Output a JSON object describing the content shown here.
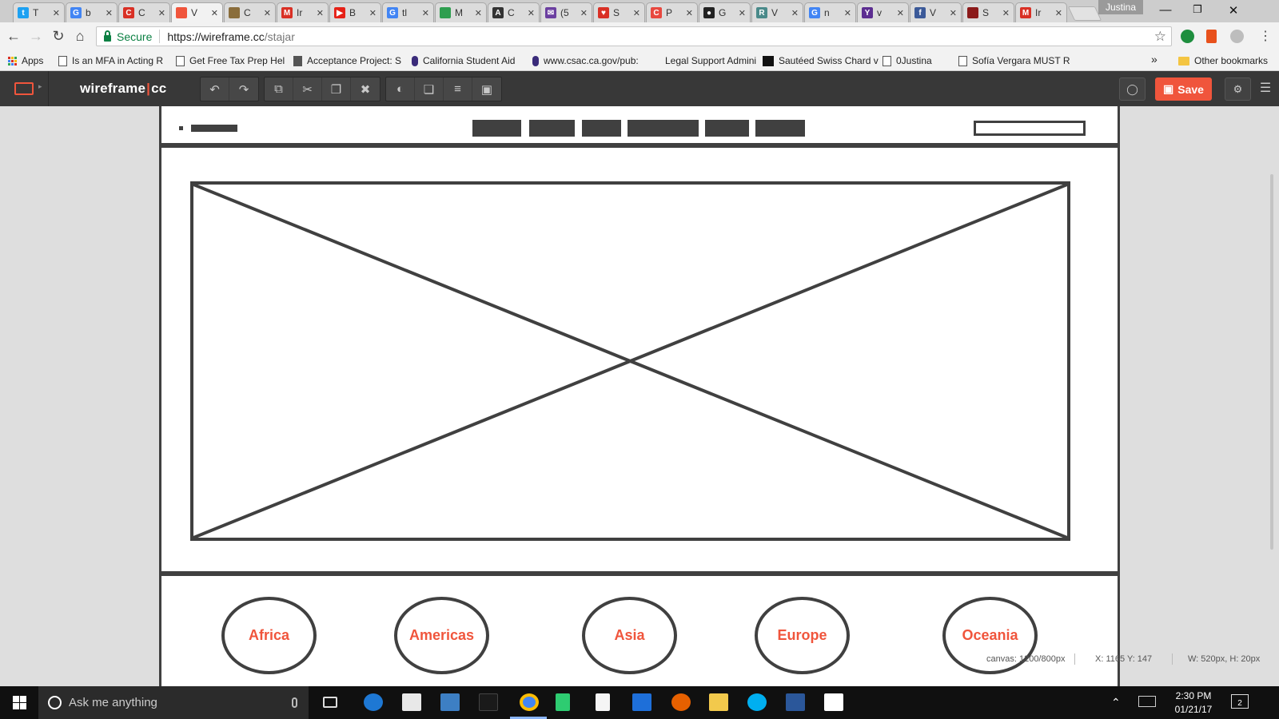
{
  "browser": {
    "tabs": [
      {
        "title": "T",
        "fav": "twitter-icon",
        "color": "#1da1f2",
        "glyph": "t"
      },
      {
        "title": "b",
        "fav": "google-icon",
        "color": "#4285f4",
        "glyph": "G"
      },
      {
        "title": "C",
        "fav": "app-icon",
        "color": "#d93025",
        "glyph": "C"
      },
      {
        "title": "V",
        "fav": "wireframe-icon",
        "color": "#f0553c",
        "glyph": "",
        "active": true
      },
      {
        "title": "C",
        "fav": "chart-icon",
        "color": "#8a6d3b",
        "glyph": ""
      },
      {
        "title": "Ir",
        "fav": "gmail-icon",
        "color": "#d93025",
        "glyph": "M"
      },
      {
        "title": "B",
        "fav": "youtube-icon",
        "color": "#e62117",
        "glyph": "▶"
      },
      {
        "title": "tl",
        "fav": "google-icon",
        "color": "#4285f4",
        "glyph": "G"
      },
      {
        "title": "M",
        "fav": "leaf-icon",
        "color": "#2e9e4f",
        "glyph": ""
      },
      {
        "title": "C",
        "fav": "circle-a-icon",
        "color": "#333333",
        "glyph": "A"
      },
      {
        "title": "(5",
        "fav": "mail-icon",
        "color": "#6b3fa0",
        "glyph": "✉"
      },
      {
        "title": "S",
        "fav": "heart-icon",
        "color": "#d93025",
        "glyph": "♥"
      },
      {
        "title": "P",
        "fav": "letter-c-icon",
        "color": "#e8483f",
        "glyph": "C"
      },
      {
        "title": "G",
        "fav": "github-icon",
        "color": "#222222",
        "glyph": "●"
      },
      {
        "title": "V",
        "fav": "r-icon",
        "color": "#4a8a8a",
        "glyph": "R"
      },
      {
        "title": "n",
        "fav": "google-icon",
        "color": "#4285f4",
        "glyph": "G"
      },
      {
        "title": "v",
        "fav": "yahoo-icon",
        "color": "#5c2d91",
        "glyph": "Y"
      },
      {
        "title": "V",
        "fav": "facebook-icon",
        "color": "#3b5998",
        "glyph": "f"
      },
      {
        "title": "S",
        "fav": "book-icon",
        "color": "#8b1a1a",
        "glyph": ""
      },
      {
        "title": "Ir",
        "fav": "gmail-icon",
        "color": "#d93025",
        "glyph": "M"
      }
    ],
    "profile_name": "Justina",
    "secure_label": "Secure",
    "url_host": "https://wireframe.cc",
    "url_path": "/stajar",
    "bookmarks": [
      {
        "label": "Apps"
      },
      {
        "label": "Is an MFA in Acting R"
      },
      {
        "label": "Get Free Tax Prep Hel"
      },
      {
        "label": "Acceptance Project: S"
      },
      {
        "label": "California Student Aid"
      },
      {
        "label": "www.csac.ca.gov/pub:"
      },
      {
        "label": "Legal Support Admini"
      },
      {
        "label": "Sautéed Swiss Chard v"
      },
      {
        "label": "0Justina"
      },
      {
        "label": "Sofía Vergara MUST R"
      }
    ],
    "bookmarks_overflow": "»",
    "other_bookmarks": "Other bookmarks"
  },
  "app": {
    "brand_left": "wireframe",
    "brand_sep": "|",
    "brand_right": "cc",
    "save_label": "Save",
    "accent_color": "#f0553c"
  },
  "wireframe": {
    "regions": [
      "Africa",
      "Americas",
      "Asia",
      "Europe",
      "Oceania"
    ]
  },
  "status": {
    "canvas": "canvas: 1200/800px",
    "coords": "X: 1165 Y: 147",
    "size": "W: 520px, H: 20px"
  },
  "taskbar": {
    "search_placeholder": "Ask me anything",
    "time": "2:30 PM",
    "date": "01/21/17",
    "notifications": "2"
  }
}
